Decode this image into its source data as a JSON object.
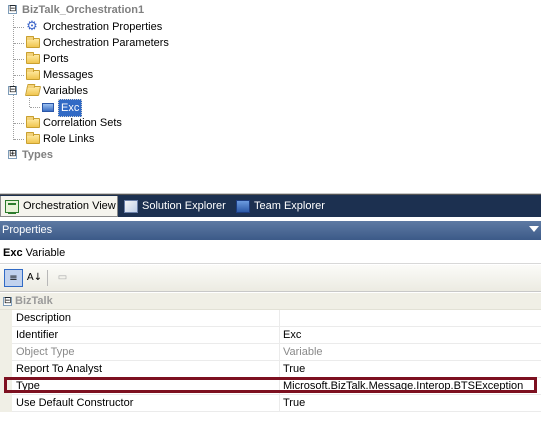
{
  "tree": {
    "root": {
      "label": "BizTalk_Orchestration1",
      "expander": "⊟"
    },
    "items": [
      {
        "label": "Orchestration Properties",
        "icon": "gear-icon"
      },
      {
        "label": "Orchestration Parameters",
        "icon": "folder-icon"
      },
      {
        "label": "Ports",
        "icon": "folder-icon"
      },
      {
        "label": "Messages",
        "icon": "folder-icon"
      },
      {
        "label": "Variables",
        "icon": "open-folder-icon",
        "expander": "⊟"
      },
      {
        "label": "Exc",
        "icon": "variable-icon",
        "selected": true
      },
      {
        "label": "Correlation Sets",
        "icon": "folder-icon"
      },
      {
        "label": "Role Links",
        "icon": "folder-icon"
      }
    ],
    "types": {
      "label": "Types",
      "expander": "⊞"
    }
  },
  "tabs": [
    {
      "label": "Orchestration View",
      "active": true,
      "icon": "orchestration-view-icon"
    },
    {
      "label": "Solution Explorer",
      "active": false,
      "icon": "solution-explorer-icon"
    },
    {
      "label": "Team Explorer",
      "active": false,
      "icon": "team-explorer-icon"
    }
  ],
  "properties": {
    "title": "Properties",
    "object_name": "Exc",
    "object_type": "Variable",
    "toolbar": {
      "categorized": "≡",
      "alphabetical": "A↓",
      "pages": "▭"
    },
    "category": {
      "label": "BizTalk",
      "expander": "⊟"
    },
    "rows": [
      {
        "name": "Description",
        "value": ""
      },
      {
        "name": "Identifier",
        "value": "Exc"
      },
      {
        "name": "Object Type",
        "value": "Variable",
        "readonly": true
      },
      {
        "name": "Report To Analyst",
        "value": "True"
      },
      {
        "name": "Type",
        "value": "Microsoft.BizTalk.Message.Interop.BTSException",
        "highlighted": true
      },
      {
        "name": "Use Default Constructor",
        "value": "True"
      }
    ]
  },
  "colors": {
    "highlight_border": "#7d1020",
    "selection": "#316ac5",
    "tab_strip": "#1c3050",
    "header": "#4a6894"
  }
}
